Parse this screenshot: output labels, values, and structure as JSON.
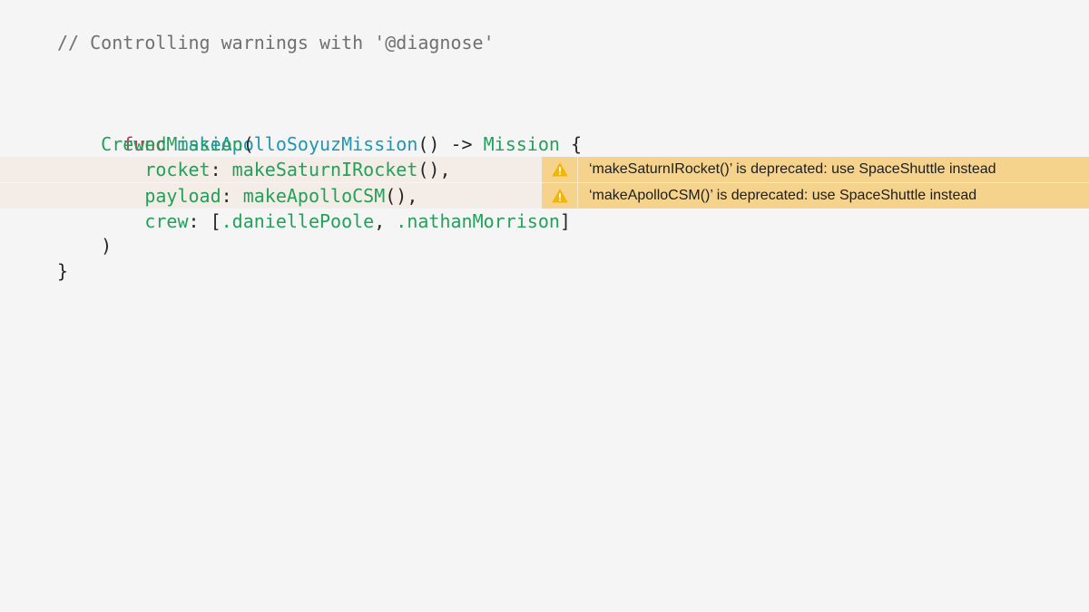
{
  "code": {
    "comment": "// Controlling warnings with '@diagnose'",
    "line1": {
      "kw": "func",
      "name": "makeApolloSoyuzMission",
      "sig_open": "() -> ",
      "ret_type": "Mission",
      "sig_close": " {"
    },
    "line2": {
      "call": "CrewedMission",
      "paren": "("
    },
    "line3": {
      "label": "rocket",
      "colon": ": ",
      "value": "makeSaturnIRocket",
      "tail": "(),"
    },
    "line4": {
      "label": "payload",
      "colon": ": ",
      "value": "makeApolloCSM",
      "tail": "(),"
    },
    "line5": {
      "label": "crew",
      "colon": ": [",
      "value1": ".daniellePoole",
      "sep": ", ",
      "value2": ".nathanMorrison",
      "tail": "]"
    },
    "line6": ")",
    "line7": "}"
  },
  "warnings": [
    {
      "icon": "warning-triangle-icon",
      "message": "‘makeSaturnIRocket()’ is deprecated: use SpaceShuttle instead"
    },
    {
      "icon": "warning-triangle-icon",
      "message": "‘makeApolloCSM()’ is deprecated: use SpaceShuttle instead"
    }
  ],
  "colors": {
    "background": "#f5f5f5",
    "keyword": "#cb2a5e",
    "function": "#1e97b1",
    "type": "#23a05a",
    "warning_band": "#f5d38c",
    "flagged_line": "#f4ece6",
    "warning_icon": "#f2b705"
  }
}
